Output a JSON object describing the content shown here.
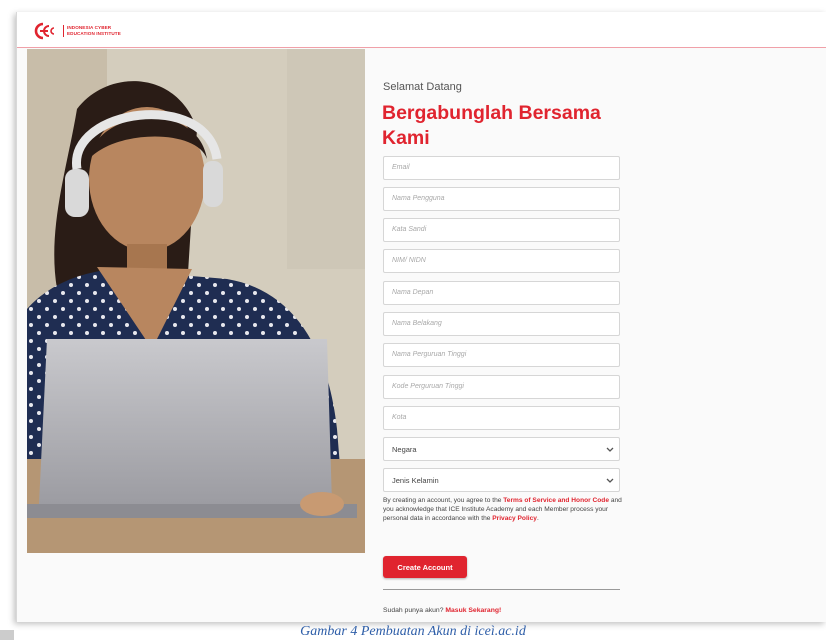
{
  "brand": {
    "logo_line1": "INDONESIA CYBER",
    "logo_line2": "EDUCATION INSTITUTE",
    "accent": "#e0242f"
  },
  "form": {
    "welcome": "Selamat Datang",
    "title": "Bergabunglah Bersama Kami",
    "fields": {
      "email": "Email",
      "username": "Nama Pengguna",
      "password": "Kata Sandi",
      "nim": "NIM/ NIDN",
      "first_name": "Nama Depan",
      "last_name": "Nama Belakang",
      "university": "Nama Perguruan Tinggi",
      "university_code": "Kode Perguruan Tinggi",
      "city": "Kota"
    },
    "selects": {
      "country": "Negara",
      "gender": "Jenis Kelamin"
    },
    "terms": {
      "part1": "By creating an account, you agree to the ",
      "tos_link": "Terms of Service and Honor Code",
      "part2": " and you acknowledge that ICE Institute Academy and each Member process your personal data in accordance with the ",
      "privacy_link": "Privacy Policy",
      "part3": "."
    },
    "create_button": "Create Account",
    "login_prompt": "Sudah punya akun? ",
    "login_link": "Masuk Sekarang!"
  },
  "caption": "Gambar 4 Pembuatan Akun di iceì.ac.id"
}
